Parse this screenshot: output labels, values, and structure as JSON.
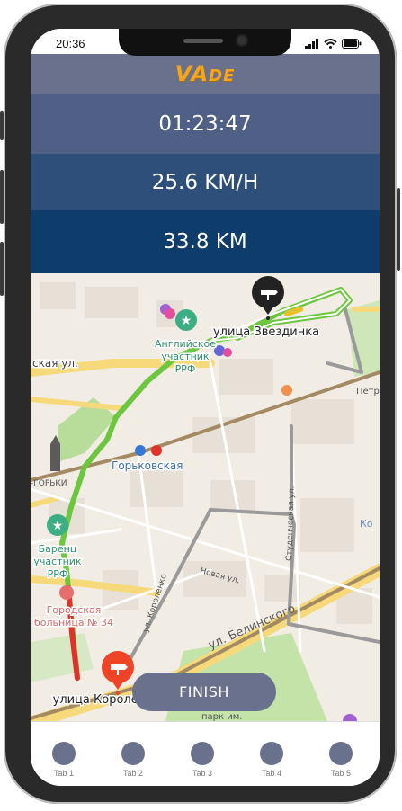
{
  "status_bar": {
    "time": "20:36"
  },
  "app": {
    "logo_main": "VA",
    "logo_rest": "DE"
  },
  "stats": {
    "duration": "01:23:47",
    "speed": "25.6 KM/H",
    "distance": "33.8 KM"
  },
  "map": {
    "labels": {
      "street_top": "улица Звездинка",
      "street_bottom": "улица Королёва",
      "street_left": "ская ул.",
      "metro": "Горьковская",
      "poi_english_1": "Английское",
      "poi_english_2": "участник",
      "poi_english_3": "РРФ",
      "poi_barents_1": "Баренц",
      "poi_barents_2": "участник",
      "poi_barents_3": "РРФ",
      "hospital_1": "Городская",
      "hospital_2": "больница № 34",
      "street_belinsky": "ул. Белинского",
      "street_novaya": "Новая ул.",
      "street_korolenko": "ул. Короленко",
      "street_studencheskaya": "Студенческая ул.",
      "street_petr": "Петр",
      "street_ko": "Ко",
      "park": "парк им.",
      "left_gorky": "-ГОРЬКИ"
    },
    "route_colors": {
      "fast": "#6cc63f",
      "slow": "#e0322a",
      "medium": "#e8c229"
    }
  },
  "actions": {
    "finish_label": "FINISH"
  },
  "tabs": [
    {
      "label": "Tab 1"
    },
    {
      "label": "Tab 2"
    },
    {
      "label": "Tab 3"
    },
    {
      "label": "Tab 4"
    },
    {
      "label": "Tab 5"
    }
  ],
  "colors": {
    "header": "#6a718d",
    "logo": "#f7a51c",
    "stat_time_bg": "#4f5f86",
    "stat_speed_bg": "#2e4f79",
    "stat_distance_bg": "#0e3c6b"
  }
}
